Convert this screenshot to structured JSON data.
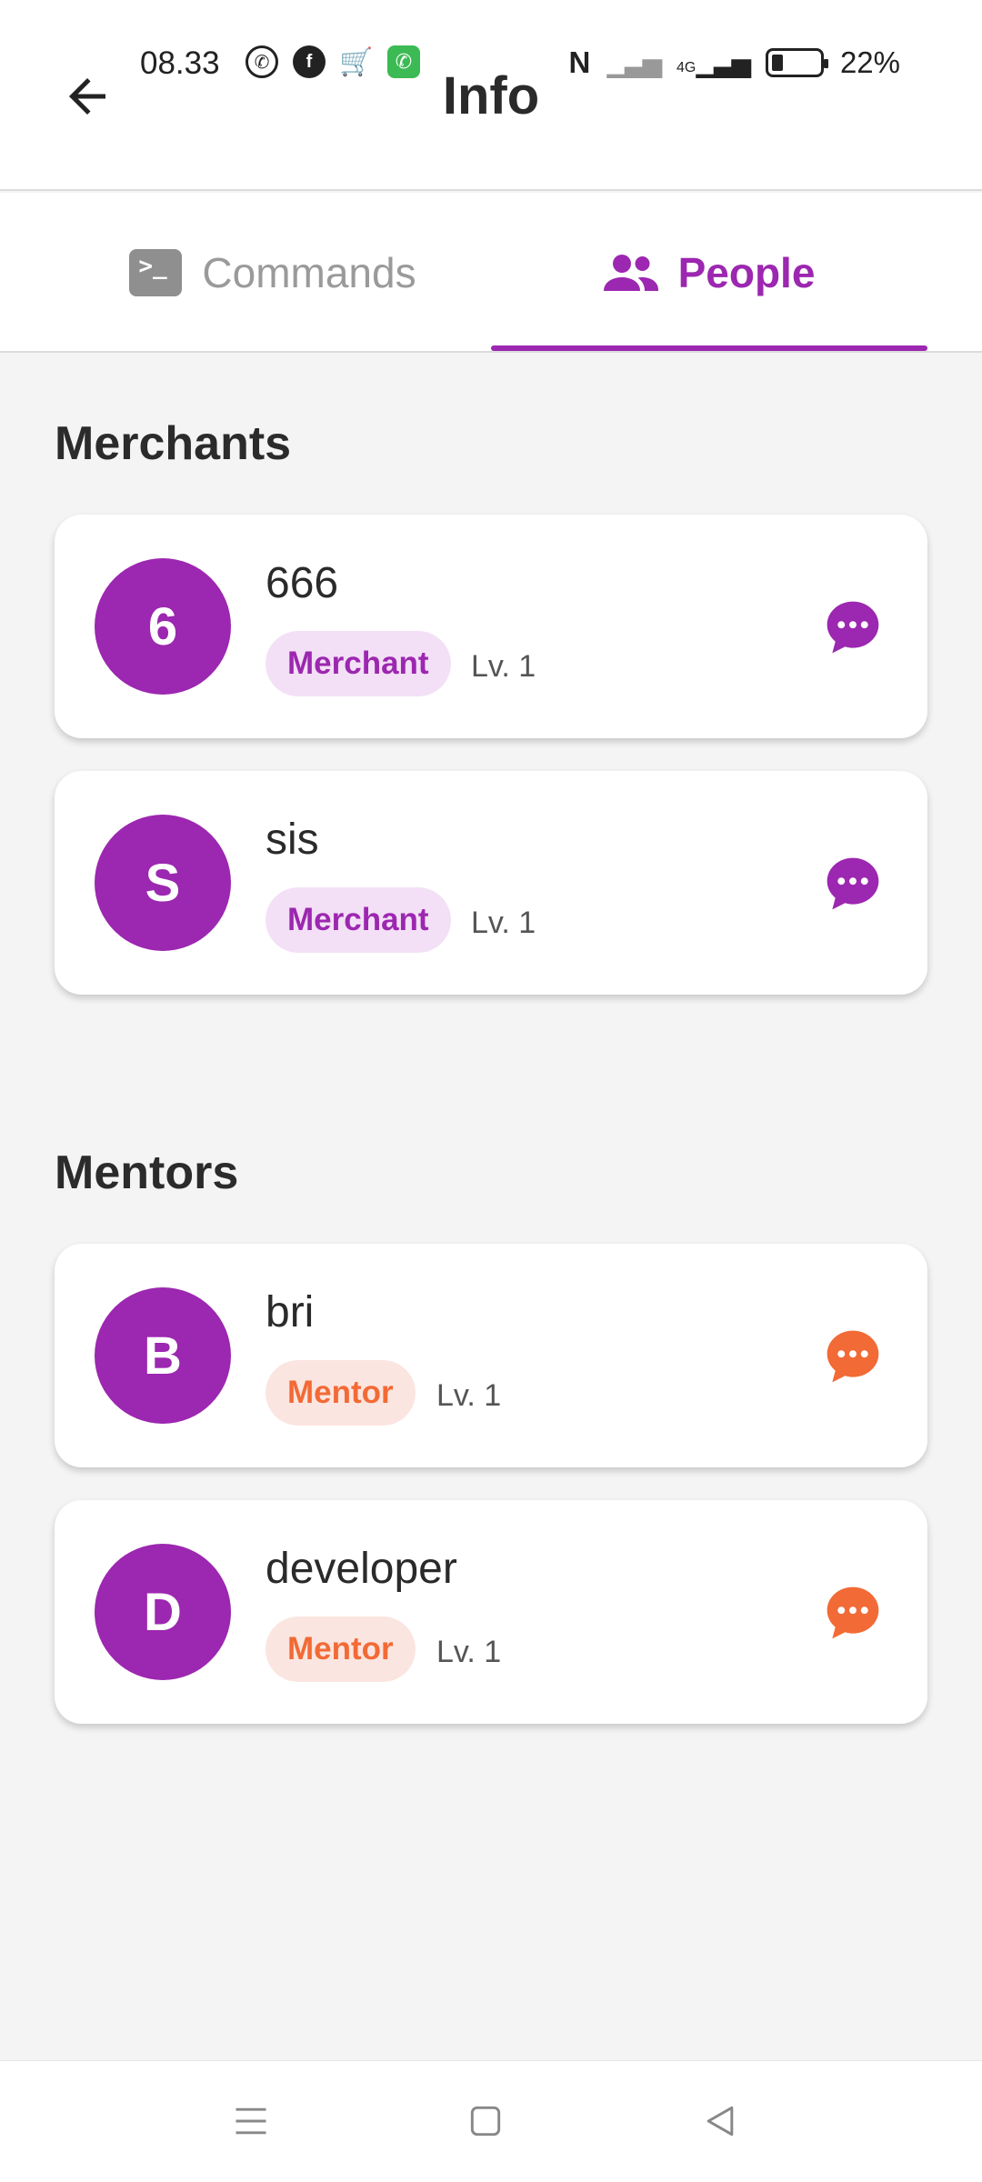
{
  "status_bar": {
    "time": "08.33",
    "battery_percent": "22%",
    "network_label": "4G"
  },
  "header": {
    "title": "Info"
  },
  "tabs": [
    {
      "label": "Commands",
      "icon": "terminal-icon",
      "active": false
    },
    {
      "label": "People",
      "icon": "people-icon",
      "active": true
    }
  ],
  "sections": {
    "merchants": {
      "title": "Merchants",
      "items": [
        {
          "initial": "6",
          "name": "666",
          "role": "Merchant",
          "level": "Lv. 1"
        },
        {
          "initial": "S",
          "name": "sis",
          "role": "Merchant",
          "level": "Lv. 1"
        }
      ]
    },
    "mentors": {
      "title": "Mentors",
      "items": [
        {
          "initial": "B",
          "name": "bri",
          "role": "Mentor",
          "level": "Lv. 1"
        },
        {
          "initial": "D",
          "name": "developer",
          "role": "Mentor",
          "level": "Lv. 1"
        }
      ]
    }
  },
  "colors": {
    "accent": "#9c27b0",
    "merchant_badge_bg": "#f3e0f6",
    "mentor_accent": "#f26a35",
    "mentor_badge_bg": "#fbe5e0"
  }
}
